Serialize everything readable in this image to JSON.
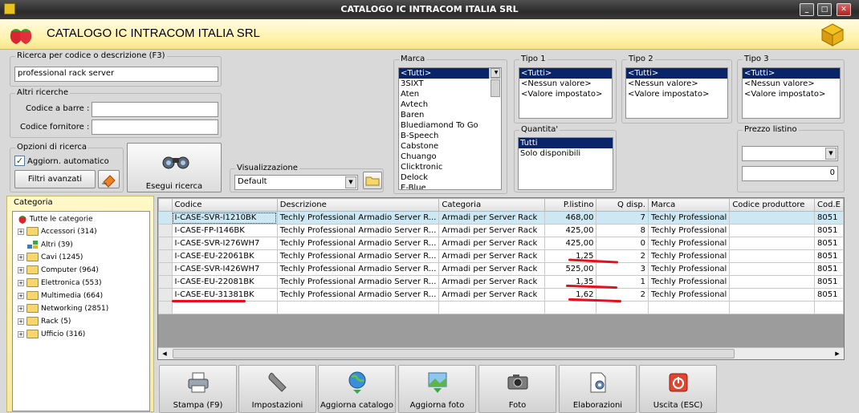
{
  "window": {
    "title": "CATALOGO IC INTRACOM ITALIA SRL",
    "controls": [
      "_",
      "□",
      "✕"
    ]
  },
  "header": {
    "title": "CATALOGO IC INTRACOM ITALIA SRL"
  },
  "search": {
    "label": "Ricerca per codice o descrizione (F3)",
    "value": "professional rack server",
    "other_label": "Altri ricerche",
    "barcode_label": "Codice a barre :",
    "barcode_value": "",
    "supplier_label": "Codice fornitore :",
    "supplier_value": ""
  },
  "options": {
    "label": "Opzioni di ricerca",
    "auto_update_label": "Aggiorn. automatico",
    "auto_update_checked": true,
    "filters_label": "Filtri avanzati",
    "execute_label": "Esegui ricerca"
  },
  "view": {
    "label": "Visualizzazione",
    "value": "Default"
  },
  "brand": {
    "label": "Marca",
    "items": [
      "<Tutti>",
      "3SIXT",
      "Aten",
      "Avtech",
      "Baren",
      "Bluediamond To Go",
      "B-Speech",
      "Cabstone",
      "Chuango",
      "Clicktronic",
      "Delock",
      "E-Blue"
    ]
  },
  "tipo1": {
    "label": "Tipo 1",
    "items": [
      "<Tutti>",
      "<Nessun valore>",
      "<Valore impostato>"
    ]
  },
  "tipo2": {
    "label": "Tipo 2",
    "items": [
      "<Tutti>",
      "<Nessun valore>",
      "<Valore impostato>"
    ]
  },
  "tipo3": {
    "label": "Tipo 3",
    "items": [
      "<Tutti>",
      "<Nessun valore>",
      "<Valore impostato>"
    ]
  },
  "quantity": {
    "label": "Quantita'",
    "items": [
      "Tutti",
      "Solo disponibili"
    ]
  },
  "price": {
    "label": "Prezzo listino",
    "select_value": "",
    "value": "0"
  },
  "category": {
    "label": "Categoria",
    "root": "Tutte le categorie",
    "items": [
      {
        "label": "Accessori (314)",
        "expandable": true
      },
      {
        "label": "Altri (39)",
        "expandable": false
      },
      {
        "label": "Cavi (1245)",
        "expandable": true
      },
      {
        "label": "Computer (964)",
        "expandable": true
      },
      {
        "label": "Elettronica (553)",
        "expandable": true
      },
      {
        "label": "Multimedia (664)",
        "expandable": true
      },
      {
        "label": "Networking (2851)",
        "expandable": true
      },
      {
        "label": "Rack (5)",
        "expandable": true
      },
      {
        "label": "Ufficio (316)",
        "expandable": true
      }
    ]
  },
  "grid": {
    "columns": [
      "Codice",
      "Descrizione",
      "Categoria",
      "P.listino",
      "Q disp.",
      "Marca",
      "Codice produttore",
      "Cod.E"
    ],
    "rows": [
      [
        "I-CASE-SVR-I1210BK",
        "Techly Professional Armadio Server R...",
        "Armadi per Server Rack",
        "468,00",
        "7",
        "Techly Professional",
        "",
        "8051"
      ],
      [
        "I-CASE-FP-I146BK",
        "Techly Professional Armadio Server R...",
        "Armadi per Server Rack",
        "425,00",
        "8",
        "Techly Professional",
        "",
        "8051"
      ],
      [
        "I-CASE-SVR-I276WH7",
        "Techly Professional Armadio Server R...",
        "Armadi per Server Rack",
        "425,00",
        "0",
        "Techly Professional",
        "",
        "8051"
      ],
      [
        "I-CASE-EU-22061BK",
        "Techly Professional Armadio Server R...",
        "Armadi per Server Rack",
        "1,25",
        "2",
        "Techly Professional",
        "",
        "8051"
      ],
      [
        "I-CASE-SVR-I426WH7",
        "Techly Professional Armadio Server R...",
        "Armadi per Server Rack",
        "525,00",
        "3",
        "Techly Professional",
        "",
        "8051"
      ],
      [
        "I-CASE-EU-22081BK",
        "Techly Professional Armadio Server R...",
        "Armadi per Server Rack",
        "1,35",
        "1",
        "Techly Professional",
        "",
        "8051"
      ],
      [
        "I-CASE-EU-31381BK",
        "Techly Professional Armadio Server R...",
        "Armadi per Server Rack",
        "1,62",
        "2",
        "Techly Professional",
        "",
        "8051"
      ]
    ]
  },
  "toolbar": {
    "print": "Stampa (F9)",
    "settings": "Impostazioni",
    "update_catalog": "Aggiorna catalogo",
    "update_photos": "Aggiorna foto",
    "photo": "Foto",
    "processing": "Elaborazioni",
    "exit": "Uscita (ESC)"
  }
}
